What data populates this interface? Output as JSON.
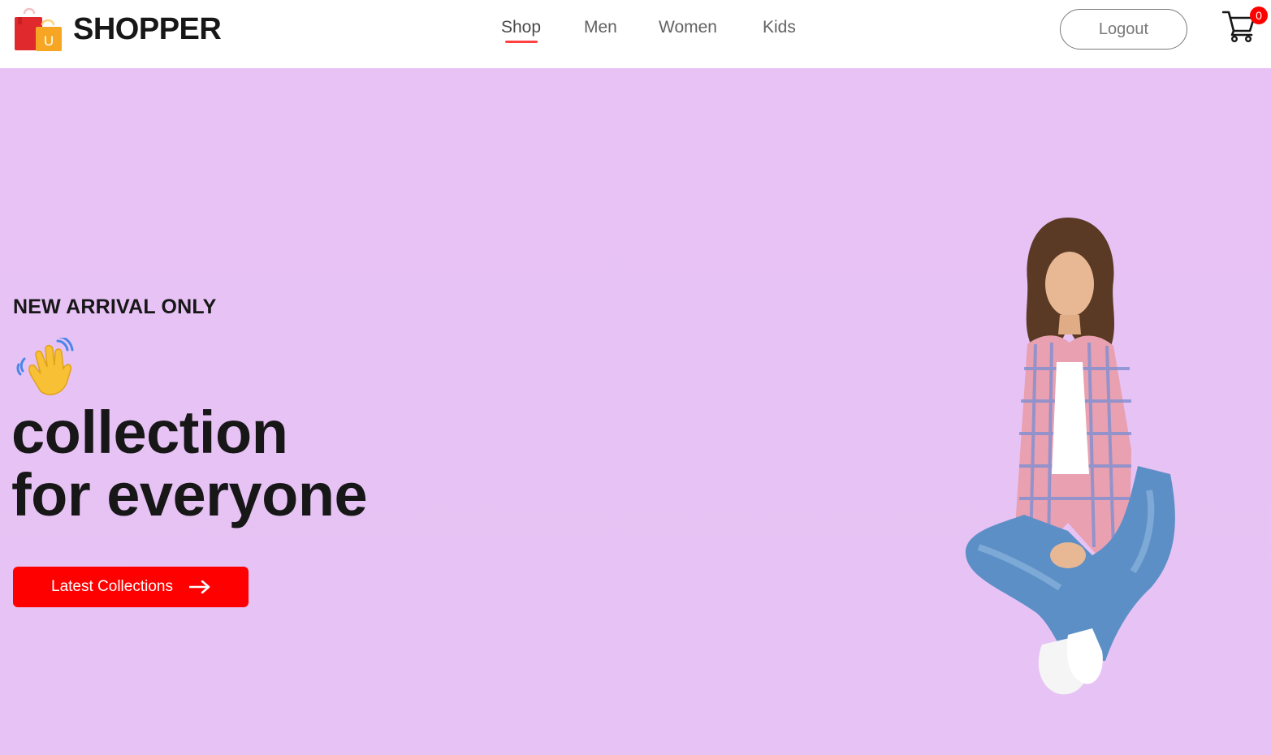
{
  "brand": {
    "name": "SHOPPER",
    "logo_icon": "shopping-bags-icon",
    "logo_letter": "U"
  },
  "nav": {
    "items": [
      {
        "label": "Shop",
        "active": true
      },
      {
        "label": "Men",
        "active": false
      },
      {
        "label": "Women",
        "active": false
      },
      {
        "label": "Kids",
        "active": false
      }
    ]
  },
  "header": {
    "logout_label": "Logout",
    "cart_icon": "cart-icon",
    "cart_count": "0"
  },
  "hero": {
    "kicker": "NEW ARRIVAL ONLY",
    "hand_icon": "waving-hand-icon",
    "headline_line1": "collection",
    "headline_line2": "for everyone",
    "cta_label": "Latest Collections",
    "cta_icon": "arrow-right-icon",
    "image": "model-woman-sitting-image"
  },
  "colors": {
    "accent": "#ff0000",
    "hero_background": "#e8c2f5",
    "nav_underline": "#ff4141",
    "text_dark": "#171717"
  }
}
